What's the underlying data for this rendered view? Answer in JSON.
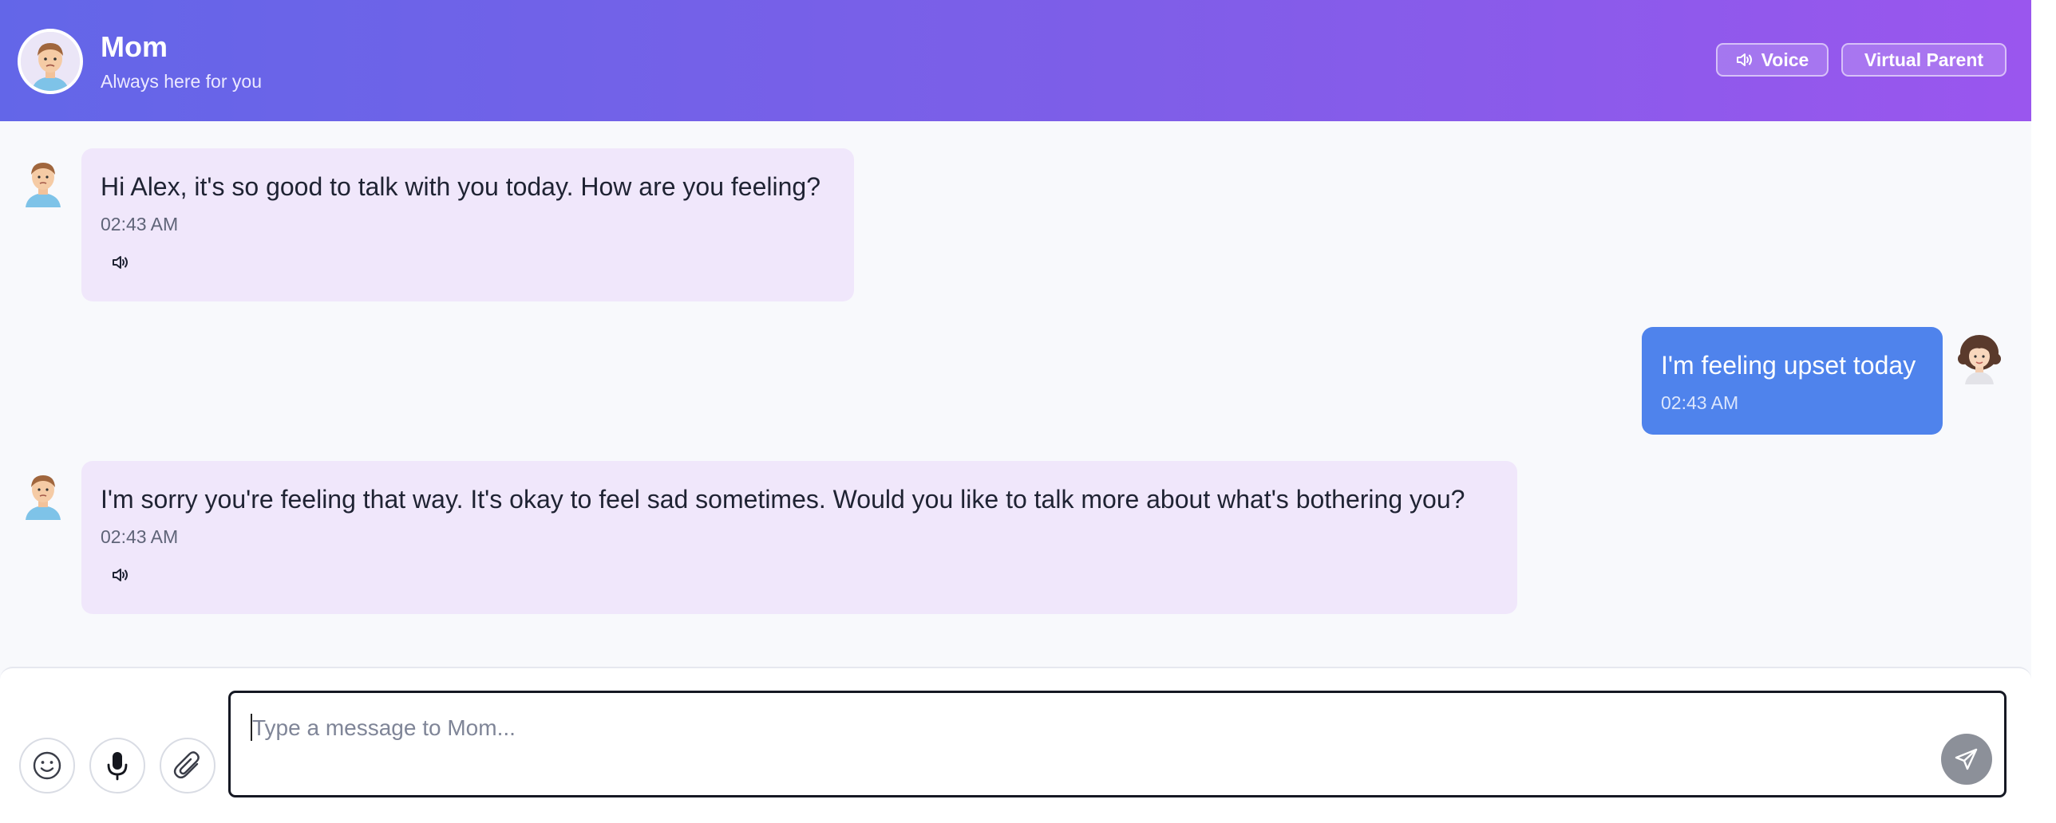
{
  "header": {
    "title": "Mom",
    "subtitle": "Always here for you",
    "voice_button": "Voice",
    "virtual_parent_button": "Virtual Parent"
  },
  "messages": [
    {
      "sender": "mom",
      "text": "Hi Alex, it's so good to talk with you today. How are you feeling?",
      "time": "02:43 AM"
    },
    {
      "sender": "user",
      "text": "I'm feeling upset today",
      "time": "02:43 AM"
    },
    {
      "sender": "mom",
      "text": "I'm sorry you're feeling that way. It's okay to feel sad sometimes. Would you like to talk more about what's bothering you?",
      "time": "02:43 AM"
    }
  ],
  "input": {
    "placeholder": "Type a message to Mom...",
    "value": ""
  },
  "icons": {
    "header_avatar": "mom-avatar-icon",
    "speaker": "speaker-icon",
    "emoji": "smiley-icon",
    "mic": "microphone-icon",
    "attach": "paperclip-icon",
    "send": "send-icon"
  },
  "colors": {
    "header_gradient_start": "#6366e8",
    "header_gradient_end": "#9a56ee",
    "incoming_bubble": "#f0e7fb",
    "outgoing_bubble": "#4f83ec",
    "send_button": "#8c9099"
  }
}
